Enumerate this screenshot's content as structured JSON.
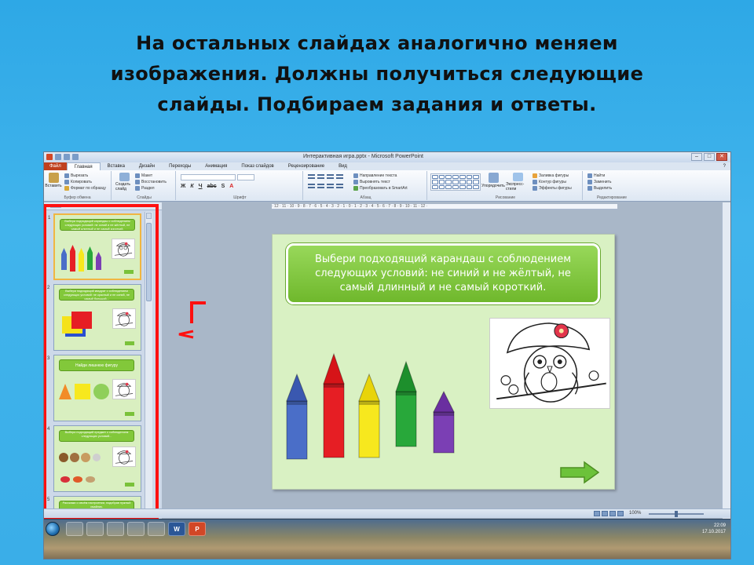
{
  "page": {
    "title_lines": [
      "На остальных слайдах аналогично меняем",
      "изображения. Должны получиться следующие",
      "слайды. Подбираем задания и ответы."
    ]
  },
  "window": {
    "title": "Интерактивная игра.pptx - Microsoft PowerPoint",
    "controls": [
      "–",
      "□",
      "✕"
    ]
  },
  "ribbon": {
    "tabs": [
      "Файл",
      "Главная",
      "Вставка",
      "Дизайн",
      "Переходы",
      "Анимация",
      "Показ слайдов",
      "Рецензирование",
      "Вид"
    ],
    "active_tab": "Главная",
    "groups": [
      {
        "label": "Буфер обмена",
        "items": [
          "Вставить",
          "Вырезать",
          "Копировать",
          "Формат по образцу"
        ]
      },
      {
        "label": "Слайды",
        "items": [
          "Создать слайд",
          "Макет",
          "Восстановить",
          "Раздел"
        ]
      },
      {
        "label": "Шрифт",
        "items": []
      },
      {
        "label": "Абзац",
        "items": [
          "Направление текста",
          "Выровнять текст",
          "Преобразовать в SmartArt"
        ]
      },
      {
        "label": "Рисование",
        "items": [
          "Упорядочить",
          "Экспресс-стили",
          "Заливка фигуры",
          "Контур фигуры",
          "Эффекты фигуры"
        ]
      },
      {
        "label": "Редактирование",
        "items": [
          "Найти",
          "Заменить",
          "Выделить"
        ]
      }
    ]
  },
  "slides_pane": {
    "thumbnails": [
      {
        "number": "1",
        "banner": "Выбери подходящий карандаш с соблюдением следующих условий: не синий и не жёлтый, не самый длинный и не самый короткий."
      },
      {
        "number": "2",
        "banner": "Выбери подходящий квадрат с соблюдением следующих условий: не красный и не синий, не самый большой..."
      },
      {
        "number": "3",
        "banner": "Найди лишнюю фигуру"
      },
      {
        "number": "4",
        "banner": "Выбери подходящий предмет с соблюдением следующих условий..."
      },
      {
        "number": "5",
        "banner": "Расскажи о своём настроении, подобрав нужный смайлик."
      }
    ]
  },
  "slide": {
    "banner_text": "Выбери подходящий карандаш с соблюдением следующих условий: не синий и не жёлтый, не самый длинный и не самый короткий.",
    "pencils": [
      {
        "color": "#4a6ec8",
        "tip": "#3a58b0"
      },
      {
        "color": "#e61e24",
        "tip": "#d61418"
      },
      {
        "color": "#f7e81e",
        "tip": "#e8d40a"
      },
      {
        "color": "#28a83a",
        "tip": "#1d8f2c"
      },
      {
        "color": "#7b3fb4",
        "tip": "#6a2fa0"
      }
    ],
    "next_arrow_color": "#6cc23a"
  },
  "statusbar": {
    "zoom": "100%"
  },
  "taskbar": {
    "apps": [
      "",
      "",
      "",
      "",
      "",
      "W",
      "P"
    ],
    "clock_time": "22:09",
    "clock_date": "17.10.2017"
  },
  "colors": {
    "background": "#3aaee8",
    "highlight_frame": "#ff1010"
  }
}
